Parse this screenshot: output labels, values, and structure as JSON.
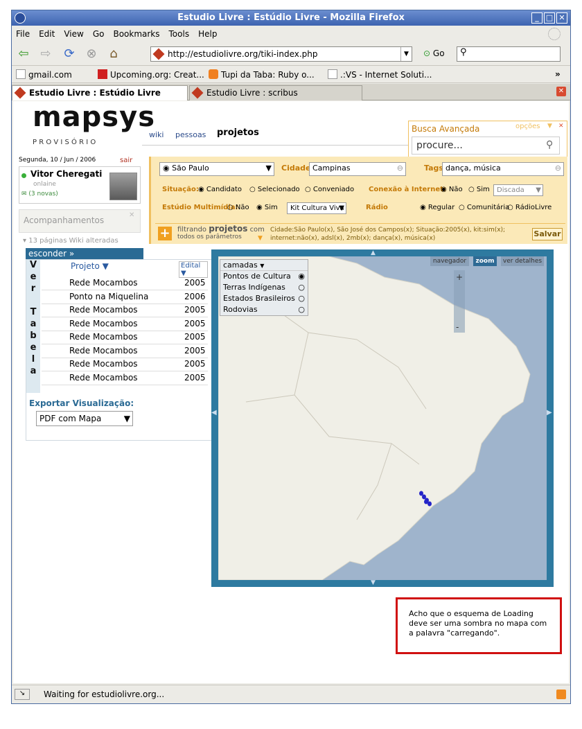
{
  "window": {
    "title": "Estudio Livre : Estúdio Livre - Mozilla Firefox"
  },
  "menu": [
    "File",
    "Edit",
    "View",
    "Go",
    "Bookmarks",
    "Tools",
    "Help"
  ],
  "nav": {
    "url": "http://estudiolivre.org/tiki-index.php",
    "go": "Go"
  },
  "bookmarks": [
    "gmail.com",
    "Upcoming.org: Creat...",
    "Tupi da Taba: Ruby o...",
    ".:VS - Internet Soluti..."
  ],
  "bookmarks_more": "»",
  "tabs": [
    "Estudio Livre : Estúdio Livre",
    "Estudio Livre : scribus"
  ],
  "site": {
    "logo": "mapsys",
    "logo_sub": "P R O V I S Ó R I O",
    "date": "Segunda, 10 / Jun / 2006",
    "logout": "sair",
    "user": "Vitor Cheregati",
    "user_status": "onlaine",
    "messages": "(3 novas)",
    "tracking_title": "Acompanhamentos",
    "tracking_item": "13 páginas Wiki alteradas",
    "nav_tabs": [
      "wiki",
      "pessoas",
      "projetos"
    ],
    "search": {
      "title": "Busca Avançada",
      "options": "opções",
      "placeholder": "procure..."
    },
    "filters": {
      "state": "São Paulo",
      "city_label": "Cidade:",
      "city": "Campinas",
      "tags_label": "Tags:",
      "tags": "dança, música",
      "situacao_label": "Situação:",
      "situacao_opts": [
        "Candidato",
        "Selecionado",
        "Conveniado"
      ],
      "conexao_label": "Conexão à Internet:",
      "conexao_opts": [
        "Não",
        "Sim"
      ],
      "conexao_sel": "Discada",
      "estudio_label": "Estúdio Multimídia:",
      "estudio_opts": [
        "Não",
        "Sim"
      ],
      "estudio_sel": "Kit Cultura Viva",
      "radio_label": "Rádio",
      "radio_opts": [
        "Regular",
        "Comunitária",
        "RádioLivre"
      ],
      "filtering_pre": "filtrando",
      "filtering_bold": "projetos",
      "filtering_post": "com",
      "all_params": "todos os parâmetros",
      "summary1": "Cidade:São Paulo(x), São José dos Campos(x); Situação:2005(x), kit:sim(x);",
      "summary2": "internet:não(x), adsl(x), 2mb(x); dança(x), música(x)",
      "save": "Salvar"
    },
    "table_panel": {
      "hide": "esconder »",
      "vertical_label": [
        "V",
        "e",
        "r",
        "",
        "T",
        "a",
        "b",
        "e",
        "l",
        "a"
      ],
      "col_project": "Projeto ▼",
      "col_edital": "Edital ▼",
      "rows": [
        [
          "Rede Mocambos",
          "2005"
        ],
        [
          "Ponto na Miquelina",
          "2006"
        ],
        [
          "Rede Mocambos",
          "2005"
        ],
        [
          "Rede Mocambos",
          "2005"
        ],
        [
          "Rede Mocambos",
          "2005"
        ],
        [
          "Rede Mocambos",
          "2005"
        ],
        [
          "Rede Mocambos",
          "2005"
        ],
        [
          "Rede Mocambos",
          "2005"
        ]
      ],
      "export_label": "Exportar Visualização:",
      "export_sel": "PDF com Mapa"
    },
    "map": {
      "layers_title": "camadas",
      "layers": [
        "Pontos de Cultura",
        "Terras Indígenas",
        "Estados Brasileiros",
        "Rodovias"
      ],
      "buttons": [
        "navegador",
        "zoom",
        "ver detalhes"
      ],
      "colors": {
        "water": "#9fb4cc",
        "land": "#f0efe7",
        "frame": "#2e7aa0",
        "points": "#2424c8"
      }
    },
    "note": "Acho que o esquema de Loading deve ser uma sombra no mapa com a palavra \"carregando\"."
  },
  "status": "Waiting for estudiolivre.org..."
}
